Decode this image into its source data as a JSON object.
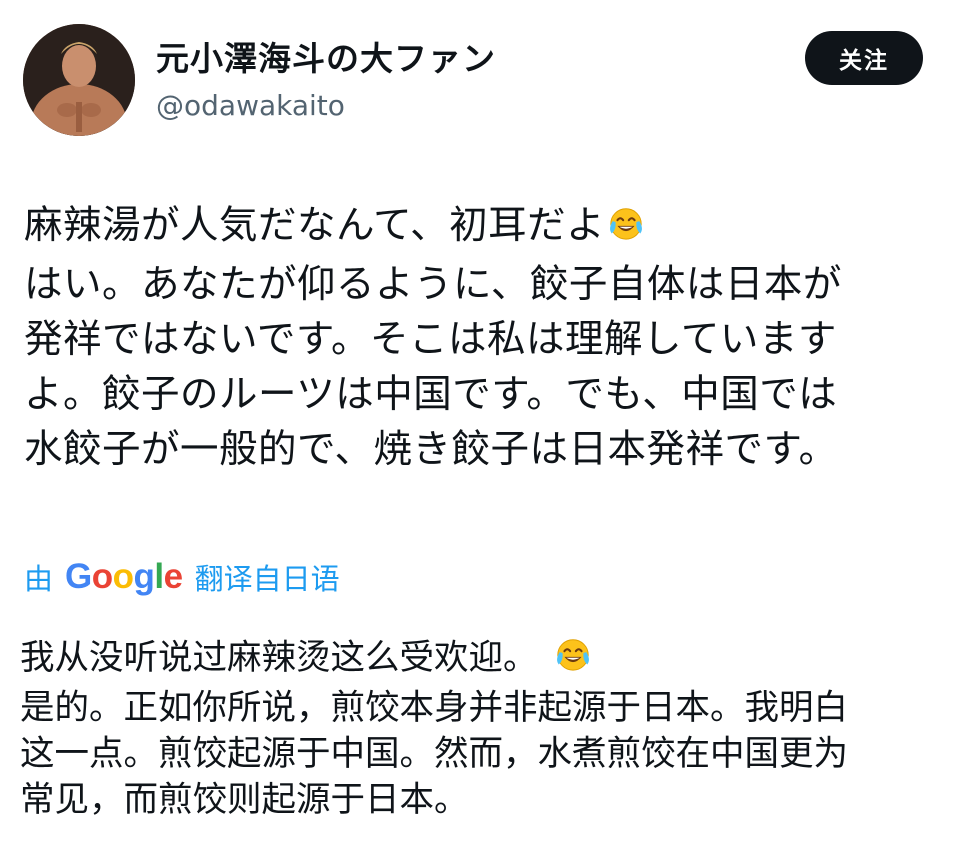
{
  "header": {
    "display_name": "元小澤海斗の大ファン",
    "handle": "@odawakaito",
    "follow_label": "关注"
  },
  "tweet": {
    "original_lines": [
      "麻辣湯が人気だなんて、初耳だよ",
      "はい。あなたが仰るように、餃子自体は日本が",
      "発祥ではないです。そこは私は理解しています",
      "よ。餃子のルーツは中国です。でも、中国では",
      "水餃子が一般的で、焼き餃子は日本発祥です。"
    ],
    "emoji_icon": "face-with-tears-of-joy-icon"
  },
  "translation": {
    "prefix": "由",
    "provider_logo": "Google",
    "suffix": "翻译自日语",
    "lines": [
      "我从没听说过麻辣烫这么受欢迎。",
      "是的。正如你所说，煎饺本身并非起源于日本。我明白",
      "这一点。煎饺起源于中国。然而，水煮煎饺在中国更为",
      "常见，而煎饺则起源于日本。"
    ]
  },
  "colors": {
    "text": "#0f1419",
    "secondary": "#536471",
    "link": "#1d9bf0",
    "button_bg": "#0f1419"
  }
}
